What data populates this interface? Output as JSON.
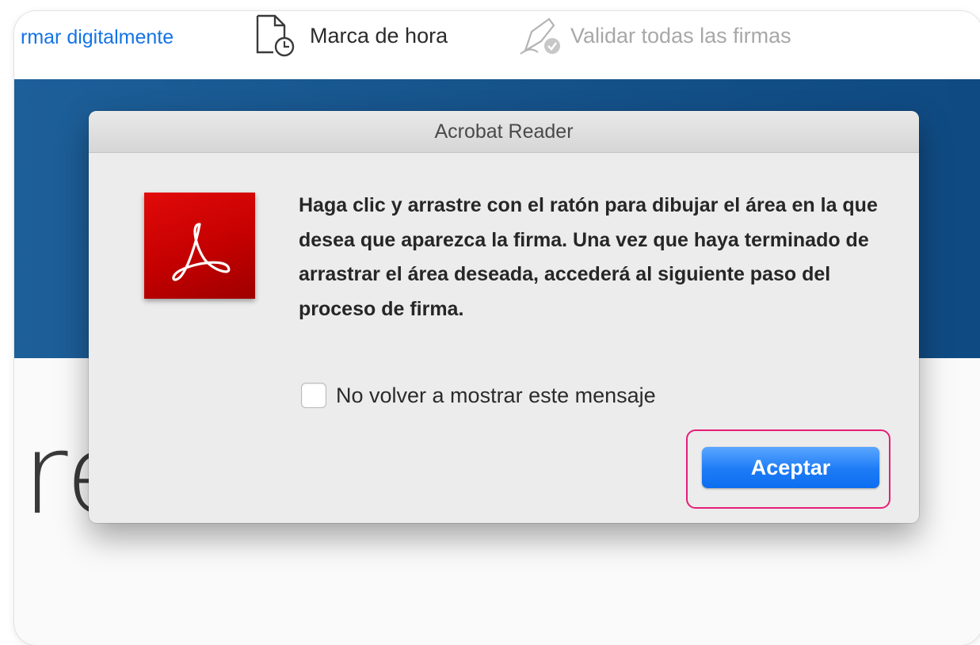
{
  "toolbar": {
    "sign_label": "rmar digitalmente",
    "timestamp_label": "Marca de hora",
    "validate_label": "Validar todas las firmas"
  },
  "background": {
    "partial_text": "re"
  },
  "dialog": {
    "title": "Acrobat Reader",
    "icon": "adobe-acrobat-icon",
    "message": "Haga clic y arrastre con el ratón para dibujar el área en la que desea que aparezca la firma. Una vez que haya terminado de arrastrar el área deseada, accederá al siguiente paso del proceso de firma.",
    "checkbox_label": "No volver a mostrar este mensaje",
    "checkbox_checked": false,
    "accept_label": "Aceptar"
  },
  "colors": {
    "link_blue": "#1473e6",
    "banner_blue": "#15528a",
    "acrobat_red": "#d00000",
    "button_blue": "#1d7bf6",
    "highlight_pink": "#e61e78"
  }
}
